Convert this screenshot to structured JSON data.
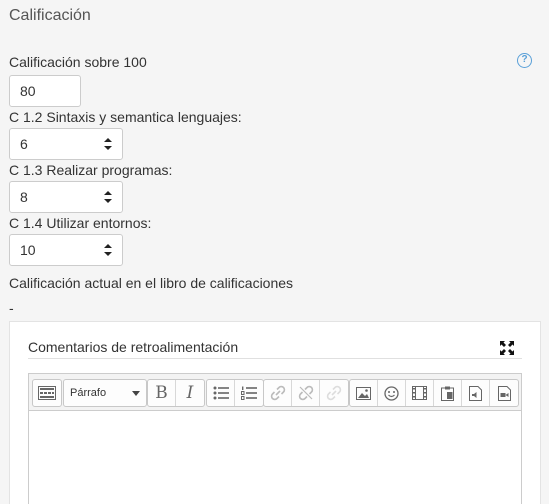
{
  "section": {
    "title": "Calificación"
  },
  "grade": {
    "label": "Calificación sobre 100",
    "value": "80",
    "help_icon": "question-circle-icon"
  },
  "criteria": [
    {
      "label": "C 1.2 Sintaxis y semantica lenguajes:",
      "value": "6"
    },
    {
      "label": "C 1.3 Realizar programas:",
      "value": "8"
    },
    {
      "label": "C 1.4 Utilizar entornos:",
      "value": "10"
    }
  ],
  "current_grade": {
    "label": "Calificación actual en el libro de calificaciones",
    "value": "-"
  },
  "feedback": {
    "title": "Comentarios de retroalimentación",
    "expand_icon": "fullscreen-icon",
    "toolbar": {
      "paragraph_format": "Párrafo",
      "bold": "B",
      "italic": "I"
    }
  },
  "colors": {
    "background": "#f5f5f5",
    "help_accent": "#5aa0d8"
  }
}
